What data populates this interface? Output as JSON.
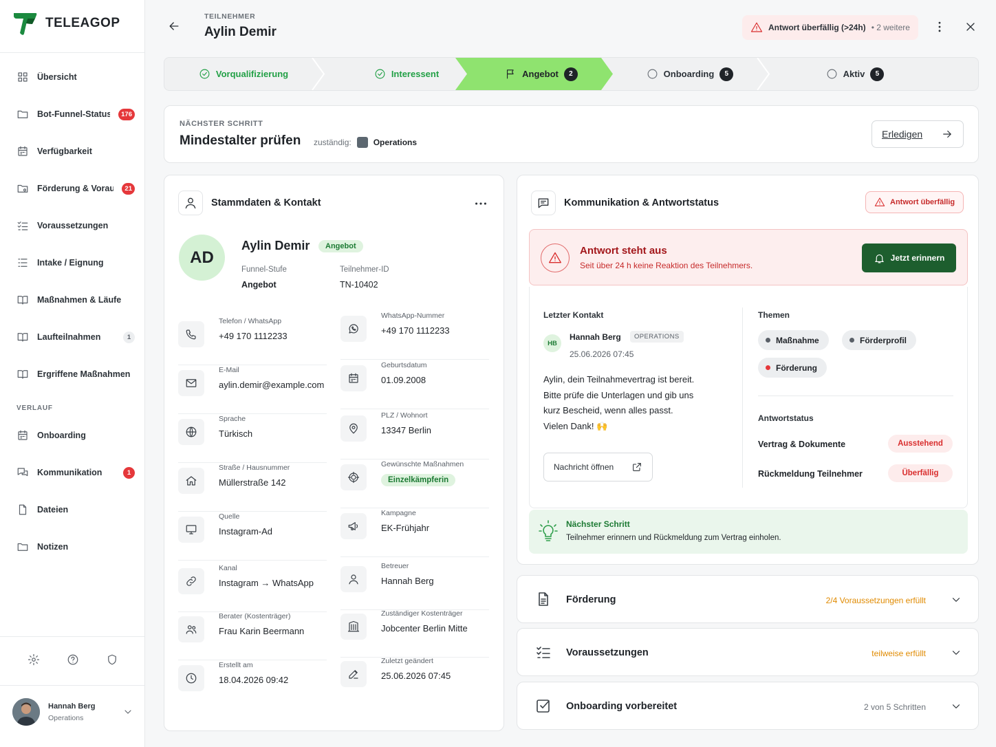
{
  "app": {
    "brand": "TELEAGOP"
  },
  "sidebar": {
    "items": [
      {
        "label": "Übersicht",
        "icon": "grid-icon",
        "badge": ""
      },
      {
        "label": "Bot-Funnel-Status",
        "icon": "folder-icon",
        "badge": "176"
      },
      {
        "label": "Verfügbarkeit",
        "icon": "calendar-icon",
        "badge": ""
      },
      {
        "label": "Förderung & Voraus.",
        "icon": "folder-cash-icon",
        "badge": "21"
      },
      {
        "label": "Voraussetzungen",
        "icon": "checklist-icon",
        "badge": ""
      },
      {
        "label": "Intake / Eignung",
        "icon": "list-icon",
        "badge": ""
      },
      {
        "label": "Maßnahmen & Läufe",
        "icon": "book-icon",
        "badge": ""
      },
      {
        "label": "Laufteilnahmen",
        "icon": "book-icon",
        "badge": "1"
      },
      {
        "label": "Ergriffene Maßnahmen",
        "icon": "book-icon",
        "badge": ""
      }
    ],
    "section_label": "VERLAUF",
    "history_items": [
      {
        "label": "Onboarding",
        "icon": "calendar-icon",
        "badge": ""
      },
      {
        "label": "Kommunikation",
        "icon": "chat-icon",
        "badge": "1"
      },
      {
        "label": "Dateien",
        "icon": "file-icon",
        "badge": ""
      },
      {
        "label": "Notizen",
        "icon": "folder-icon",
        "badge": ""
      }
    ],
    "user": {
      "name": "Hannah Berg",
      "role": "Operations"
    }
  },
  "header": {
    "kicker": "TEILNEHMER",
    "title": "Aylin Demir",
    "alert": "Antwort überfällig (>24h)",
    "alert_more": "• 2 weitere"
  },
  "stepper": [
    {
      "label": "Vorqualifizierung",
      "state": "done",
      "count": ""
    },
    {
      "label": "Interessent",
      "state": "done",
      "count": ""
    },
    {
      "label": "Angebot",
      "state": "active",
      "count": "2"
    },
    {
      "label": "Onboarding",
      "state": "todo",
      "count": "5"
    },
    {
      "label": "Aktiv",
      "state": "todo",
      "count": "5"
    }
  ],
  "next_step": {
    "kicker": "NÄCHSTER SCHRITT",
    "title": "Mindestalter prüfen",
    "responsible_label": "zuständig:",
    "responsible": "Operations",
    "action": "Erledigen"
  },
  "stammdaten": {
    "title": "Stammdaten & Kontakt",
    "initials": "AD",
    "name": "Aylin Demir",
    "stage_tag": "Angebot",
    "funnel_label": "Funnel-Stufe",
    "funnel_value": "Angebot",
    "id_label": "Teilnehmer-ID",
    "id_value": "TN-10402",
    "left_fields": [
      {
        "label": "Telefon / WhatsApp",
        "value": "+49 170 1112233",
        "icon": "phone-icon"
      },
      {
        "label": "E-Mail",
        "value": "aylin.demir@example.com",
        "icon": "mail-icon"
      },
      {
        "label": "Sprache",
        "value": "Türkisch",
        "icon": "globe-icon"
      },
      {
        "label": "Straße / Hausnummer",
        "value": "Müllerstraße 142",
        "icon": "home-icon"
      },
      {
        "label": "Quelle",
        "value": "Instagram-Ad",
        "icon": "monitor-icon"
      },
      {
        "label": "Kanal",
        "value": "Instagram → WhatsApp",
        "icon": "link-icon"
      },
      {
        "label": "Berater (Kostenträger)",
        "value": "Frau Karin Beermann",
        "icon": "users-icon"
      },
      {
        "label": "Erstellt am",
        "value": "18.04.2026 09:42",
        "icon": "clock-icon"
      }
    ],
    "right_fields": [
      {
        "label": "WhatsApp-Nummer",
        "value": "+49 170 1112233",
        "icon": "whatsapp-icon"
      },
      {
        "label": "Geburtsdatum",
        "value": "01.09.2008",
        "icon": "calendar-icon"
      },
      {
        "label": "PLZ / Wohnort",
        "value": "13347 Berlin",
        "icon": "pin-icon"
      },
      {
        "label": "Gewünschte Maßnahmen",
        "value": "Einzelkämpferin",
        "icon": "target-icon",
        "tag": true
      },
      {
        "label": "Kampagne",
        "value": "EK-Frühjahr",
        "icon": "megaphone-icon"
      },
      {
        "label": "Betreuer",
        "value": "Hannah Berg",
        "icon": "user-icon"
      },
      {
        "label": "Zuständiger Kostenträger",
        "value": "Jobcenter Berlin Mitte",
        "icon": "building-icon"
      },
      {
        "label": "Zuletzt geändert",
        "value": "25.06.2026 07:45",
        "icon": "edit-icon"
      }
    ]
  },
  "kommunikation": {
    "title": "Kommunikation & Antwortstatus",
    "status_pill": "Antwort überfällig",
    "alert_title": "Antwort steht aus",
    "alert_sub": "Seit über 24 h keine Reaktion des Teilnehmers.",
    "remind_button": "Jetzt erinnern",
    "last_contact_label": "Letzter Kontakt",
    "contact_initials": "HB",
    "contact_name": "Hannah Berg",
    "contact_role": "OPERATIONS",
    "contact_date": "25.06.2026 07:45",
    "message_lines": [
      "Aylin, dein Teilnahmevertrag ist bereit.",
      "Bitte prüfe die Unterlagen und gib uns",
      "kurz Bescheid, wenn alles passt.",
      "Vielen Dank! 🙌"
    ],
    "open_button": "Nachricht öffnen",
    "topics_label": "Themen",
    "topics": [
      {
        "label": "Maßnahme",
        "color": "#5a6068"
      },
      {
        "label": "Förderprofil",
        "color": "#5a6068"
      },
      {
        "label": "Förderung",
        "color": "#e5383b"
      }
    ],
    "status_label": "Antwortstatus",
    "statuses": [
      {
        "label": "Vertrag & Dokumente",
        "value": "Ausstehend"
      },
      {
        "label": "Rückmeldung Teilnehmer",
        "value": "Überfällig"
      }
    ],
    "next_title": "Nächster Schritt",
    "next_sub": "Teilnehmer erinnern und Rückmeldung zum Vertrag einholen."
  },
  "accordions": [
    {
      "title": "Förderung",
      "status": "2/4 Voraussetzungen erfüllt",
      "color": "#e08a00",
      "icon": "document-icon"
    },
    {
      "title": "Voraussetzungen",
      "status": "teilweise erfüllt",
      "color": "#e08a00",
      "icon": "checklist-icon"
    },
    {
      "title": "Onboarding vorbereitet",
      "status": "2 von 5 Schritten",
      "color": "#6b7178",
      "icon": "checkbox-icon"
    }
  ]
}
